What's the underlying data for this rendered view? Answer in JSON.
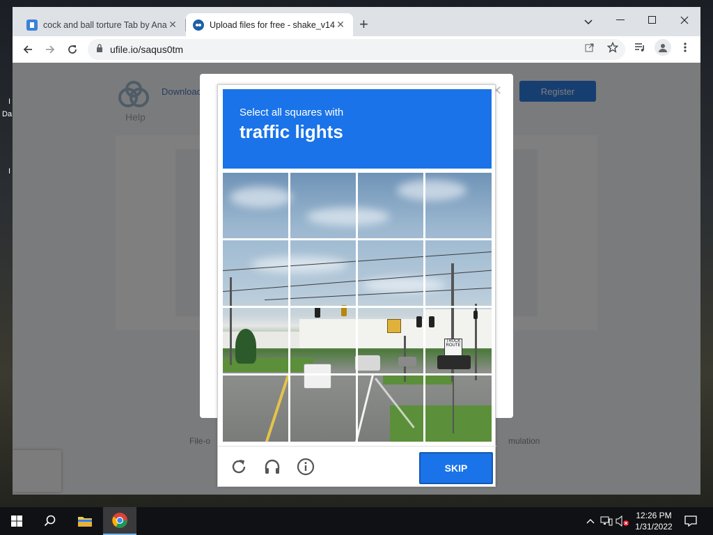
{
  "desktop": {
    "label_1": "I",
    "label_2": "Da",
    "label_3": "I"
  },
  "browser": {
    "tabs": [
      {
        "title": "cock and ball torture Tab by Anal",
        "favicon_color": "#3b82d6"
      },
      {
        "title": "Upload files for free - shake_v14",
        "favicon_color": "#1e5fa8"
      }
    ],
    "new_tab_label": "+",
    "url": "ufile.io/saqus0tm"
  },
  "page": {
    "help_label": "Help",
    "downloads_label": "Downloads",
    "register_label": "Register",
    "footer_left": "File-o",
    "footer_right": "mulation"
  },
  "captcha": {
    "instruction_line1": "Select all squares with",
    "instruction_target": "traffic lights",
    "skip_label": "SKIP",
    "grid_rows": 4,
    "grid_cols": 4,
    "sign_text": "TRUCK ROUTE",
    "header_color": "#1a73e8"
  },
  "taskbar": {
    "time": "12:26 PM",
    "date": "1/31/2022"
  }
}
